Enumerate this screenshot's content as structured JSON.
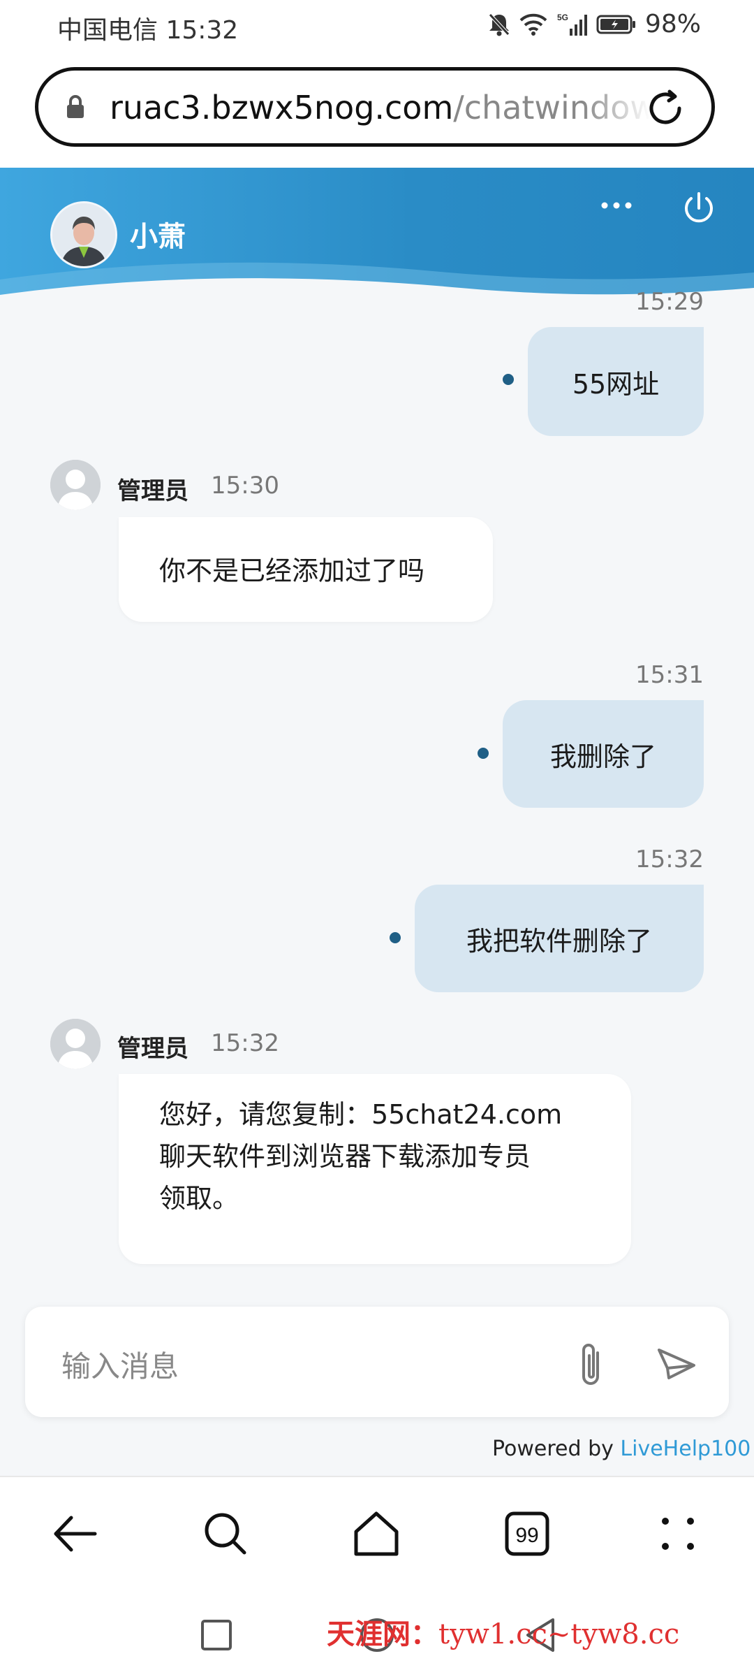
{
  "status_bar": {
    "carrier_time": "中国电信 15:32",
    "battery": "98%",
    "network": "5G"
  },
  "browser": {
    "url_host": "ruac3.bzwx5nog.com",
    "url_path": "/chatwindow"
  },
  "chat_header": {
    "agent_name": "小萧",
    "more_icon": "more-dots-icon",
    "power_icon": "power-icon"
  },
  "messages": [
    {
      "side": "right",
      "time": "15:29",
      "text": "55网址"
    },
    {
      "side": "left",
      "sender": "管理员",
      "time": "15:30",
      "text": "你不是已经添加过了吗"
    },
    {
      "side": "right",
      "time": "15:31",
      "text": "我删除了"
    },
    {
      "side": "right",
      "time": "15:32",
      "text": "我把软件删除了"
    },
    {
      "side": "left",
      "sender": "管理员",
      "time": "15:32",
      "lines": [
        "您好，请您复制：55chat24.com",
        "聊天软件到浏览器下载添加专员",
        "领取。"
      ]
    }
  ],
  "composer": {
    "placeholder": "输入消息",
    "attach_icon": "paperclip-icon",
    "send_icon": "send-icon"
  },
  "footer": {
    "powered_by": "Powered by ",
    "powered_link": "LiveHelp100"
  },
  "browser_nav": {
    "tabs_count": "99",
    "icons": [
      "back-arrow-icon",
      "search-icon",
      "home-icon",
      "tabs-icon",
      "menu-dots-icon"
    ]
  },
  "watermark": {
    "brand": "天涯网：",
    "urls": "tyw1.cc~tyw8.cc"
  },
  "colors": {
    "header_blue": "#2a8cc6",
    "bubble_out": "#d7e6f1",
    "link": "#2f9ad6",
    "watermark": "#e03030"
  }
}
